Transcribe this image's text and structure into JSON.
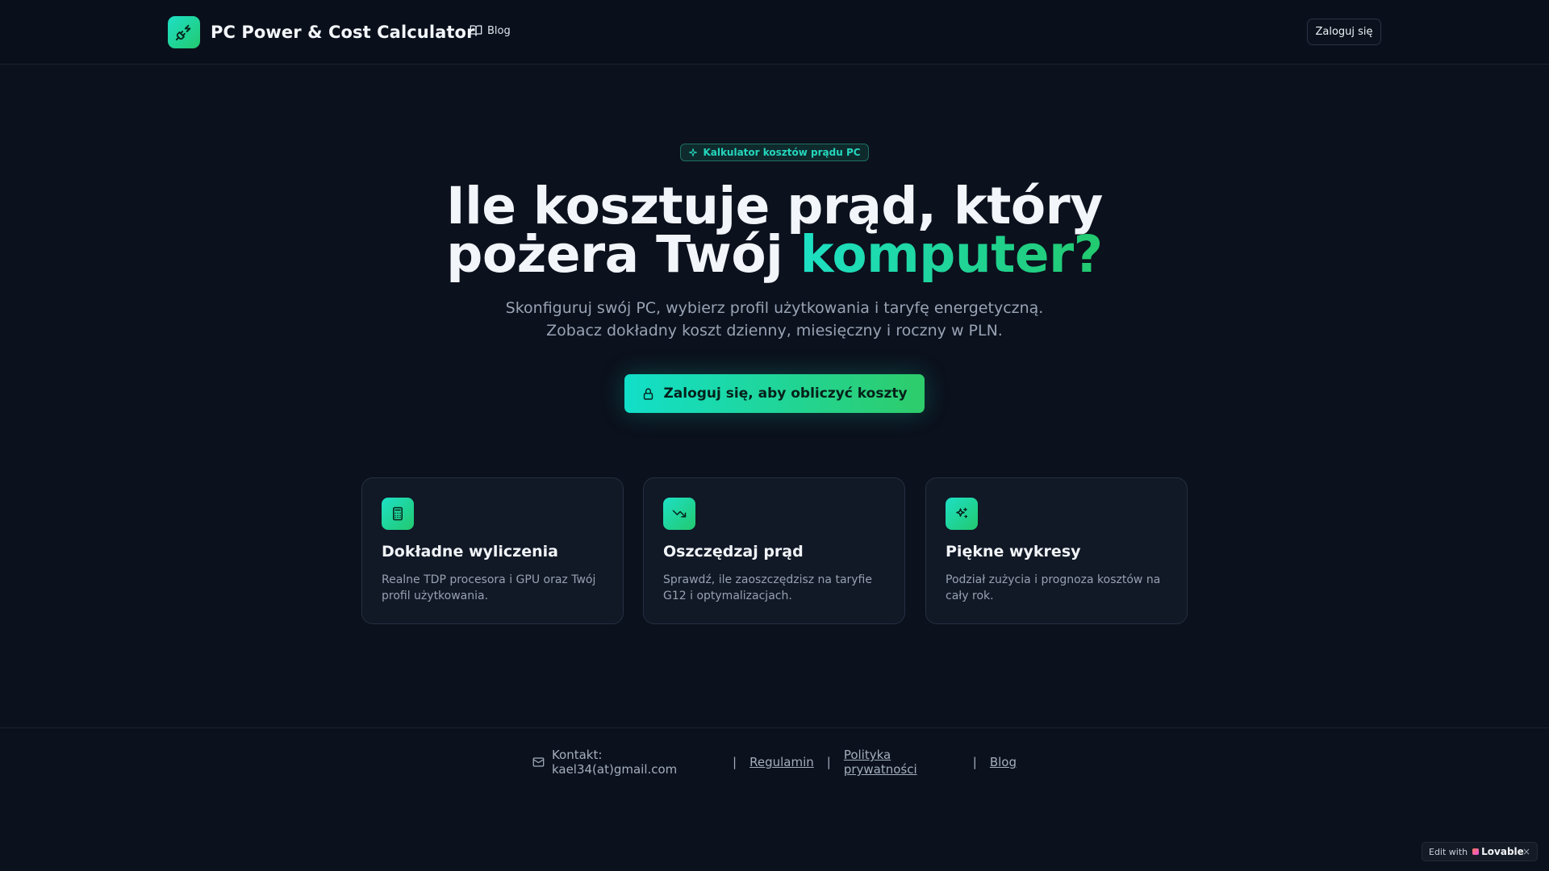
{
  "header": {
    "brand_title": "PC Power & Cost Calculator",
    "blog_label": "Blog",
    "login_label": "Zaloguj się"
  },
  "hero": {
    "badge": "Kalkulator kosztów prądu PC",
    "title_line1": "Ile kosztuje prąd, który",
    "title_line2_plain": "pożera Twój ",
    "title_line2_accent": "komputer?",
    "subtitle_line1": "Skonfiguruj swój PC, wybierz profil użytkowania i taryfę energetyczną.",
    "subtitle_line2": "Zobacz dokładny koszt dzienny, miesięczny i roczny w PLN.",
    "cta_label": "Zaloguj się, aby obliczyć koszty"
  },
  "features": [
    {
      "icon": "calculator-icon",
      "title": "Dokładne wyliczenia",
      "desc": "Realne TDP procesora i GPU oraz Twój profil użytkowania."
    },
    {
      "icon": "trending-down-icon",
      "title": "Oszczędzaj prąd",
      "desc": "Sprawdź, ile zaoszczędzisz na taryfie G12 i optymalizacjach."
    },
    {
      "icon": "sparkles-icon",
      "title": "Piękne wykresy",
      "desc": "Podział zużycia i prognoza kosztów na cały rok."
    }
  ],
  "footer": {
    "contact": "Kontakt: kael34(at)gmail.com",
    "separator": "|",
    "terms": "Regulamin",
    "privacy": "Polityka prywatności",
    "blog": "Blog"
  },
  "lovable_badge": {
    "prefix": "Edit with",
    "brand": "Lovable",
    "close": "×"
  },
  "colors": {
    "background": "#0b111d",
    "accent_start": "#1de0c4",
    "accent_end": "#22c96e"
  }
}
